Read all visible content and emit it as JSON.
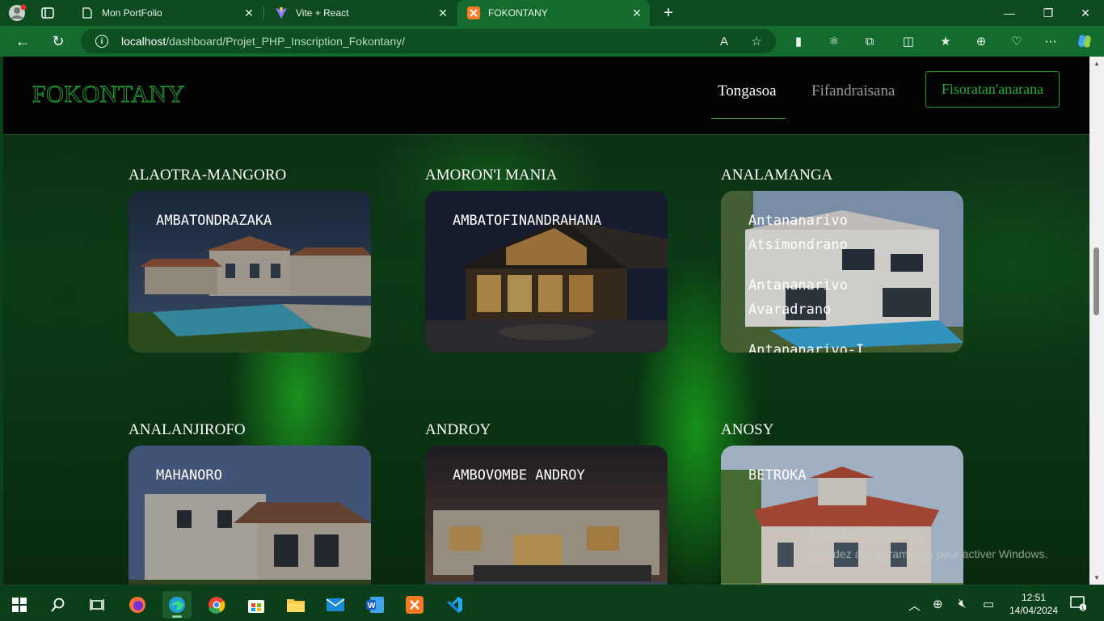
{
  "browser": {
    "tabs": [
      {
        "label": "Mon PortFolio",
        "icon": "page-icon"
      },
      {
        "label": "Vite + React",
        "icon": "vite-icon"
      },
      {
        "label": "FOKONTANY",
        "icon": "xampp-icon",
        "active": true
      }
    ],
    "url_host": "localhost",
    "url_path": "/dashboard/Projet_PHP_Inscription_Fokontany/"
  },
  "site": {
    "logo": "FOKONTANY",
    "nav": {
      "home": "Tongasoa",
      "login": "Fifandraisana",
      "register": "Fisoratan'anarana"
    }
  },
  "regions": [
    {
      "name": "ALAOTRA-MANGORO",
      "districts": [
        "AMBATONDRAZAKA"
      ]
    },
    {
      "name": "AMORON'I MANIA",
      "districts": [
        "AMBATOFINANDRAHANA"
      ]
    },
    {
      "name": "ANALAMANGA",
      "districts": [
        "Antananarivo Atsimondrano",
        "Antananarivo Avaradrano",
        "Antananarivo-I"
      ]
    },
    {
      "name": "ANALANJIROFO",
      "districts": [
        "MAHANORO"
      ]
    },
    {
      "name": "ANDROY",
      "districts": [
        "AMBOVOMBE ANDROY"
      ]
    },
    {
      "name": "ANOSY",
      "districts": [
        "BETROKA"
      ]
    }
  ],
  "watermark": {
    "title": "Activer Windows",
    "subtitle": "Accédez aux paramètres pour activer Windows."
  },
  "taskbar": {
    "time": "12:51",
    "date": "14/04/2024"
  }
}
